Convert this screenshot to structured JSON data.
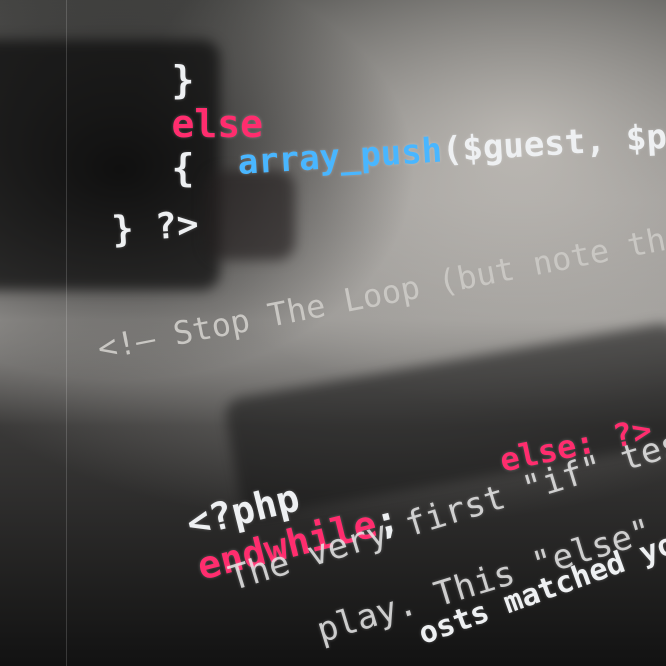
{
  "colors": {
    "keyword": "#ff2d6e",
    "function": "#49b6ff",
    "default_text": "#eef0f2",
    "comment": "#c9c7c3"
  },
  "editor": {
    "lines": [
      {
        "brace": "}",
        "keyword": "else",
        "open": "{"
      },
      {
        "function": "array_push",
        "args": "($guest, $post);"
      },
      {
        "text": "} ?>"
      },
      {
        "comment": "<!— Stop The Loop (but note the \"e"
      },
      {
        "keyword_end": "else: ?>"
      },
      {
        "php_open": "<?php",
        "keyword": "endwhile",
        "sep": ";"
      },
      {
        "comment": "The very first \"if\" tested to"
      },
      {
        "comment": "play. This \"else\" part te"
      },
      {
        "comment": "osts matched your cr"
      }
    ]
  }
}
